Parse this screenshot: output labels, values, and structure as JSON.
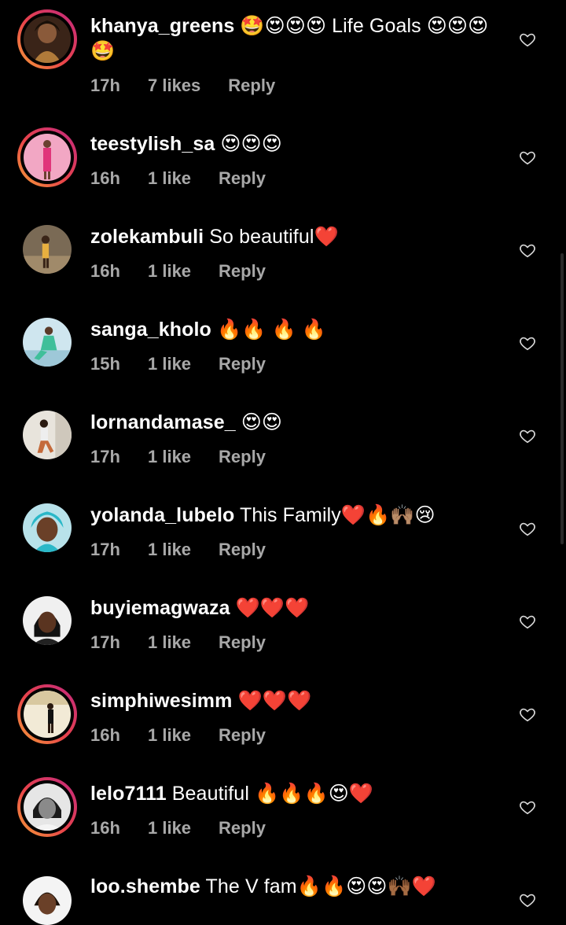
{
  "comments": [
    {
      "username": "khanya_greens",
      "text": " 🤩😍😍😍 Life Goals 😍😍😍🤩",
      "time": "17h",
      "likes": "7 likes",
      "reply": "Reply",
      "story": true
    },
    {
      "username": "teestylish_sa",
      "text": " 😍😍😍",
      "time": "16h",
      "likes": "1 like",
      "reply": "Reply",
      "story": true
    },
    {
      "username": "zolekambuli",
      "text": " So beautiful❤️",
      "time": "16h",
      "likes": "1 like",
      "reply": "Reply",
      "story": false
    },
    {
      "username": "sanga_kholo",
      "text": " 🔥🔥 🔥 🔥",
      "time": "15h",
      "likes": "1 like",
      "reply": "Reply",
      "story": false
    },
    {
      "username": "lornandamase_",
      "text": " 😍😍",
      "time": "17h",
      "likes": "1 like",
      "reply": "Reply",
      "story": false
    },
    {
      "username": "yolanda_lubelo",
      "text": " This Family❤️🔥🙌🏽😢",
      "time": "17h",
      "likes": "1 like",
      "reply": "Reply",
      "story": false
    },
    {
      "username": "buyiemagwaza",
      "text": " ❤️❤️❤️",
      "time": "17h",
      "likes": "1 like",
      "reply": "Reply",
      "story": false
    },
    {
      "username": "simphiwesimm",
      "text": " ❤️❤️❤️",
      "time": "16h",
      "likes": "1 like",
      "reply": "Reply",
      "story": true
    },
    {
      "username": "lelo7111",
      "text": " Beautiful 🔥🔥🔥😍❤️",
      "time": "16h",
      "likes": "1 like",
      "reply": "Reply",
      "story": true
    },
    {
      "username": "loo.shembe",
      "text": " The V fam🔥🔥😍😍🙌🏾❤️",
      "time": "",
      "likes": "",
      "reply": "",
      "story": false
    }
  ],
  "icons": {
    "like": "heart-outline-icon"
  },
  "colors": {
    "background": "#000000",
    "text": "#ffffff",
    "meta": "#a8a8a8",
    "story_ring_start": "#f6a037",
    "story_ring_end": "#c2287f"
  }
}
